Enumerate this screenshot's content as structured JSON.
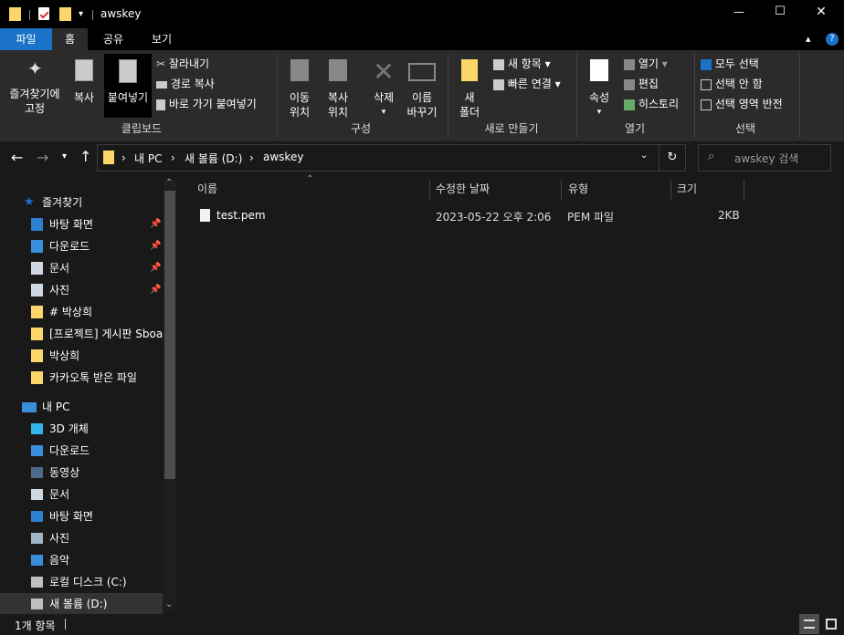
{
  "window": {
    "title": "awskey",
    "min": "—",
    "max": "☐",
    "close": "✕"
  },
  "tabs": [
    {
      "label": "파일"
    },
    {
      "label": "홈"
    },
    {
      "label": "공유"
    },
    {
      "label": "보기"
    }
  ],
  "ribbon": {
    "clipboard": {
      "pin": "즐겨찾기에\n고정",
      "copy": "복사",
      "paste": "붙여넣기",
      "cut": "잘라내기",
      "copy_path": "경로 복사",
      "paste_shortcut": "바로 가기 붙여넣기",
      "label": "클립보드"
    },
    "organize": {
      "move": "이동\n위치",
      "copyto": "복사\n위치",
      "delete": "삭제",
      "rename": "이름\n바꾸기",
      "label": "구성"
    },
    "new": {
      "new_folder": "새\n폴더",
      "new_item": "새 항목",
      "easy_access": "빠른 연결",
      "label": "새로 만들기"
    },
    "open": {
      "properties": "속성",
      "open": "열기",
      "edit": "편집",
      "history": "히스토리",
      "label": "열기"
    },
    "select": {
      "select_all": "모두 선택",
      "select_none": "선택 안 함",
      "invert": "선택 영역 반전",
      "label": "선택"
    }
  },
  "address": {
    "crumbs": [
      "내 PC",
      "새 볼륨 (D:)",
      "awskey"
    ],
    "search_placeholder": "awskey 검색"
  },
  "nav": {
    "quick_access": "즐겨찾기",
    "quick_items": [
      {
        "label": "바탕 화면",
        "pinned": true
      },
      {
        "label": "다운로드",
        "pinned": true
      },
      {
        "label": "문서",
        "pinned": true
      },
      {
        "label": "사진",
        "pinned": true
      },
      {
        "label": "# 박상희",
        "pinned": false
      },
      {
        "label": "[프로젝트] 게시판 Sboard",
        "pinned": false
      },
      {
        "label": "박상희",
        "pinned": false
      },
      {
        "label": "카카오톡 받은 파일",
        "pinned": false
      }
    ],
    "this_pc": "내 PC",
    "pc_items": [
      {
        "label": "3D 개체"
      },
      {
        "label": "다운로드"
      },
      {
        "label": "동영상"
      },
      {
        "label": "문서"
      },
      {
        "label": "바탕 화면"
      },
      {
        "label": "사진"
      },
      {
        "label": "음악"
      },
      {
        "label": "로컬 디스크 (C:)"
      },
      {
        "label": "새 볼륨 (D:)"
      }
    ]
  },
  "columns": [
    "이름",
    "수정한 날짜",
    "유형",
    "크기"
  ],
  "files": [
    {
      "name": "test.pem",
      "modified": "2023-05-22 오후 2:06",
      "type": "PEM 파일",
      "size": "2KB"
    }
  ],
  "status": {
    "count": "1개 항목"
  },
  "colors": {
    "accent": "#1a73c8",
    "folder": "#fdd66b",
    "ribbon_bg": "#2b2b2b",
    "bg": "#191919"
  }
}
